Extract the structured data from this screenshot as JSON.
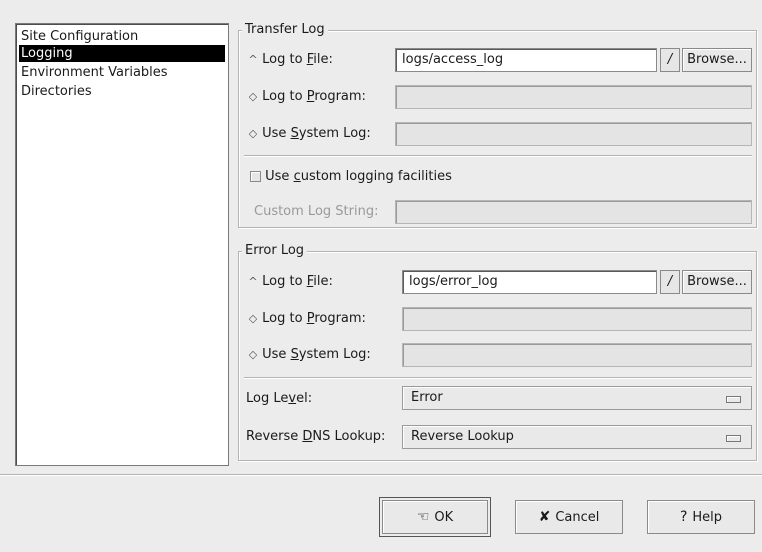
{
  "sidebar": {
    "items": [
      {
        "label": "Site Configuration",
        "selected": false
      },
      {
        "label": "Logging",
        "selected": true
      },
      {
        "label": "Environment Variables",
        "selected": false
      },
      {
        "label": "Directories",
        "selected": false
      }
    ]
  },
  "transfer_log": {
    "title": "Transfer Log",
    "log_to_file": {
      "pre": "Log to ",
      "u": "F",
      "post": "ile:",
      "value": "logs/access_log",
      "selected": true
    },
    "log_to_program": {
      "pre": "Log to ",
      "u": "P",
      "post": "rogram:",
      "value": ""
    },
    "use_system_log": {
      "pre": "Use ",
      "u": "S",
      "post": "ystem Log:",
      "value": ""
    },
    "browse_label": "Browse...",
    "combo_glyph": "/",
    "custom_logging": {
      "pre": "Use ",
      "u": "c",
      "post": "ustom logging facilities",
      "checked": false
    },
    "custom_log_string": {
      "label": "Custom Log String:",
      "value": ""
    }
  },
  "error_log": {
    "title": "Error Log",
    "log_to_file": {
      "pre": "Log to ",
      "u": "F",
      "post": "ile:",
      "value": "logs/error_log",
      "selected": true
    },
    "log_to_program": {
      "pre": "Log to ",
      "u": "P",
      "post": "rogram:",
      "value": ""
    },
    "use_system_log": {
      "pre": "Use ",
      "u": "S",
      "post": "ystem Log:",
      "value": ""
    },
    "browse_label": "Browse...",
    "combo_glyph": "/",
    "log_level": {
      "pre": "Log Le",
      "u": "v",
      "post": "el:",
      "value": "Error"
    },
    "reverse_dns": {
      "pre": "Reverse ",
      "u": "D",
      "post": "NS Lookup:",
      "value": "Reverse Lookup"
    }
  },
  "buttons": {
    "ok": "OK",
    "cancel": "Cancel",
    "help": "Help"
  },
  "icons": {
    "radio_on": "up-arrow-radio-icon",
    "radio_off": "diamond-radio-icon",
    "ok": "hand-ok-icon",
    "cancel": "x-cancel-icon",
    "help": "question-help-icon"
  }
}
